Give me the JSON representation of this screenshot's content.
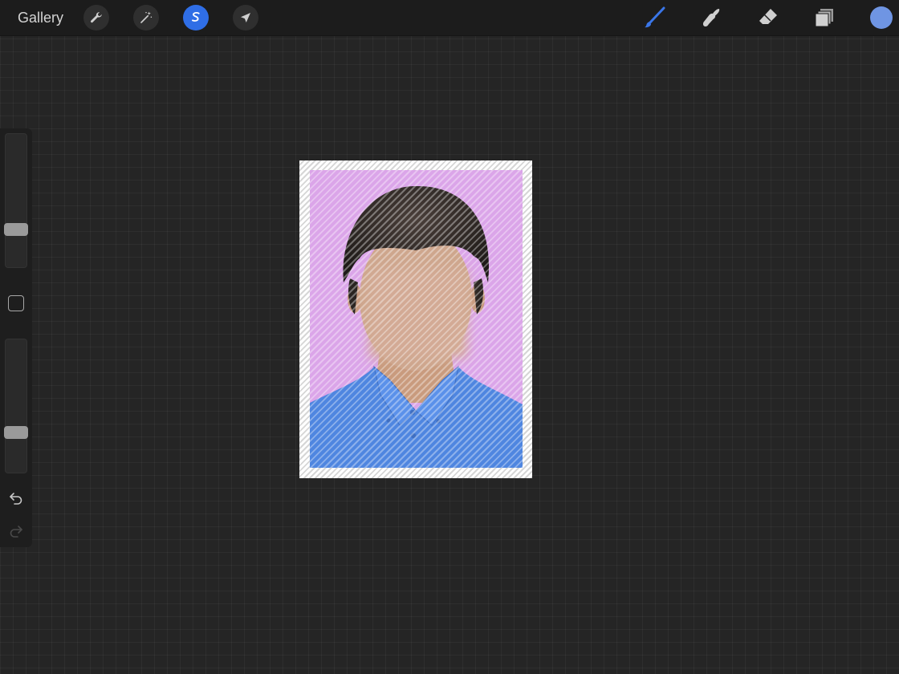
{
  "topbar": {
    "gallery_label": "Gallery",
    "left_tools": [
      {
        "name": "actions",
        "icon": "wrench-icon"
      },
      {
        "name": "adjustments",
        "icon": "magic-wand-icon"
      },
      {
        "name": "selection",
        "icon": "selection-s-icon",
        "active": true
      },
      {
        "name": "transform",
        "icon": "arrow-cursor-icon"
      }
    ],
    "right_tools": [
      {
        "name": "brush",
        "icon": "brush-icon",
        "active": true
      },
      {
        "name": "smudge",
        "icon": "smudge-finger-icon"
      },
      {
        "name": "eraser",
        "icon": "eraser-icon"
      },
      {
        "name": "layers",
        "icon": "layers-icon"
      }
    ],
    "current_color": "#6f95e3"
  },
  "sidebar": {
    "brush_size_level": 0.26,
    "opacity_level": 0.28,
    "modify_icon": "square-icon",
    "undo_icon": "undo-icon",
    "redo_icon": "redo-icon",
    "redo_enabled": false
  },
  "canvas": {
    "background_color": "#d9a6e6",
    "shirt_color": "#4f86e0",
    "selection_pattern": "diagonal-stripes",
    "face_blurred": true
  },
  "colors": {
    "accent": "#2f6ee6",
    "toolbar_bg": "#1c1c1c",
    "canvas_bg": "#252525"
  }
}
